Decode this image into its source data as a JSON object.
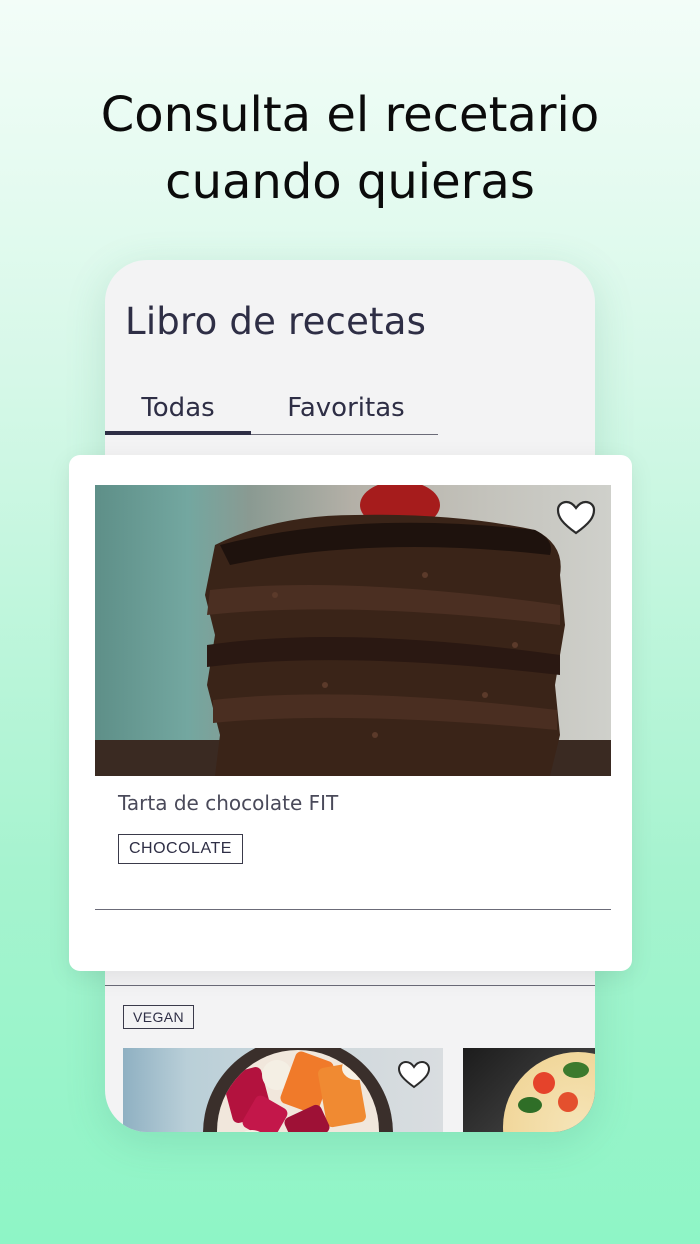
{
  "headline": {
    "line1": "Consulta el recetario",
    "line2": "cuando quieras"
  },
  "app": {
    "title": "Libro de recetas",
    "tabs": [
      {
        "label": "Todas",
        "active": true
      },
      {
        "label": "Favoritas",
        "active": false
      }
    ]
  },
  "featured_recipe": {
    "title": "Tarta de chocolate FIT",
    "tag": "CHOCOLATE",
    "image_icon": "chocolate-cake-photo",
    "favorite_icon": "heart-outline-icon"
  },
  "next_section": {
    "tag": "VEGAN",
    "cards": [
      {
        "image_icon": "fruit-bowl-photo",
        "favorite_icon": "heart-outline-icon"
      },
      {
        "image_icon": "pizza-photo"
      }
    ]
  },
  "colors": {
    "accent_dark": "#2e2e45",
    "background_mint": "#8ef5c6"
  }
}
